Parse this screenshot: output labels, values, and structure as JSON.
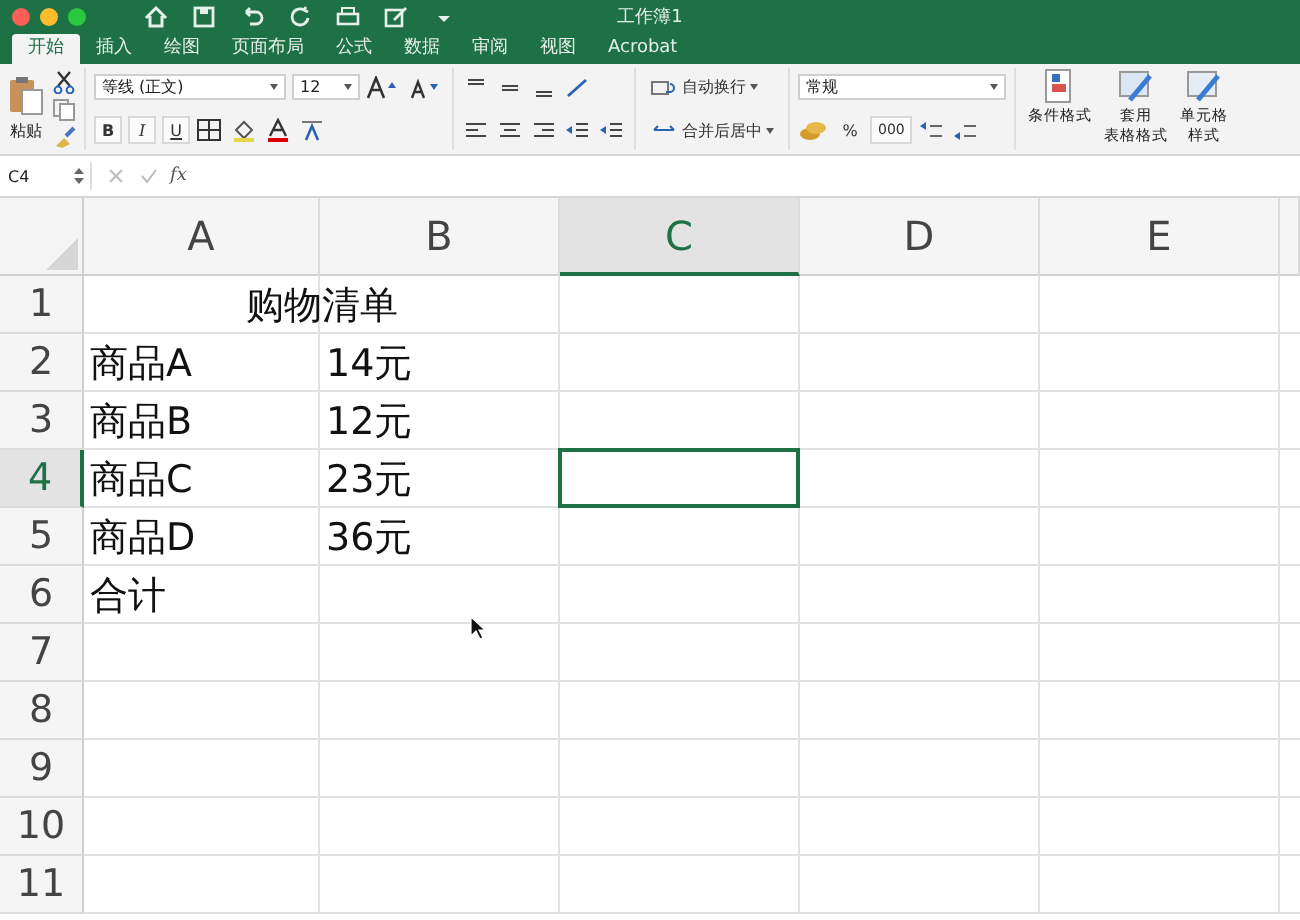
{
  "window": {
    "title": "工作簿1"
  },
  "tabs": [
    {
      "label": "开始",
      "selected": true
    },
    {
      "label": "插入",
      "selected": false
    },
    {
      "label": "绘图",
      "selected": false
    },
    {
      "label": "页面布局",
      "selected": false
    },
    {
      "label": "公式",
      "selected": false
    },
    {
      "label": "数据",
      "selected": false
    },
    {
      "label": "审阅",
      "selected": false
    },
    {
      "label": "视图",
      "selected": false
    },
    {
      "label": "Acrobat",
      "selected": false
    }
  ],
  "ribbon": {
    "paste": "粘贴",
    "font_name": "等线 (正文)",
    "font_size": "12",
    "bold": "B",
    "italic": "I",
    "underline": "U",
    "wrap_text": "自动换行",
    "merge_center": "合并后居中",
    "number_format": "常规",
    "percent": "%",
    "thousands": "000",
    "conditional_format": "条件格式",
    "table_format": [
      "套用",
      "表格格式"
    ],
    "cell_styles": [
      "单元格",
      "样式"
    ]
  },
  "formula_bar": {
    "name_box": "C4",
    "fx": "fx"
  },
  "grid": {
    "columns": [
      {
        "label": "A",
        "selected": false
      },
      {
        "label": "B",
        "selected": false
      },
      {
        "label": "C",
        "selected": true
      },
      {
        "label": "D",
        "selected": false
      },
      {
        "label": "E",
        "selected": false
      }
    ],
    "rows": [
      {
        "number": "1",
        "selected": false,
        "merged_title": "购物清单"
      },
      {
        "number": "2",
        "selected": false,
        "cells": [
          {
            "kind": "plain",
            "text": "商品A"
          },
          {
            "kind": "plain",
            "text": "14元"
          }
        ]
      },
      {
        "number": "3",
        "selected": false,
        "cells": [
          {
            "kind": "plain",
            "text": "商品B"
          },
          {
            "kind": "plain",
            "text": "12元"
          }
        ]
      },
      {
        "number": "4",
        "selected": true,
        "cells": [
          {
            "kind": "plain",
            "text": "商品C"
          },
          {
            "kind": "plain",
            "text": "23元"
          }
        ]
      },
      {
        "number": "5",
        "selected": false,
        "cells": [
          {
            "kind": "plain",
            "text": "商品D"
          },
          {
            "kind": "plain",
            "text": "36元"
          }
        ]
      },
      {
        "number": "6",
        "selected": false,
        "cells": [
          {
            "kind": "plain",
            "text": "合计"
          }
        ]
      },
      {
        "number": "7",
        "selected": false
      },
      {
        "number": "8",
        "selected": false
      },
      {
        "number": "9",
        "selected": false
      },
      {
        "number": "10",
        "selected": false
      },
      {
        "number": "11",
        "selected": false
      }
    ]
  }
}
